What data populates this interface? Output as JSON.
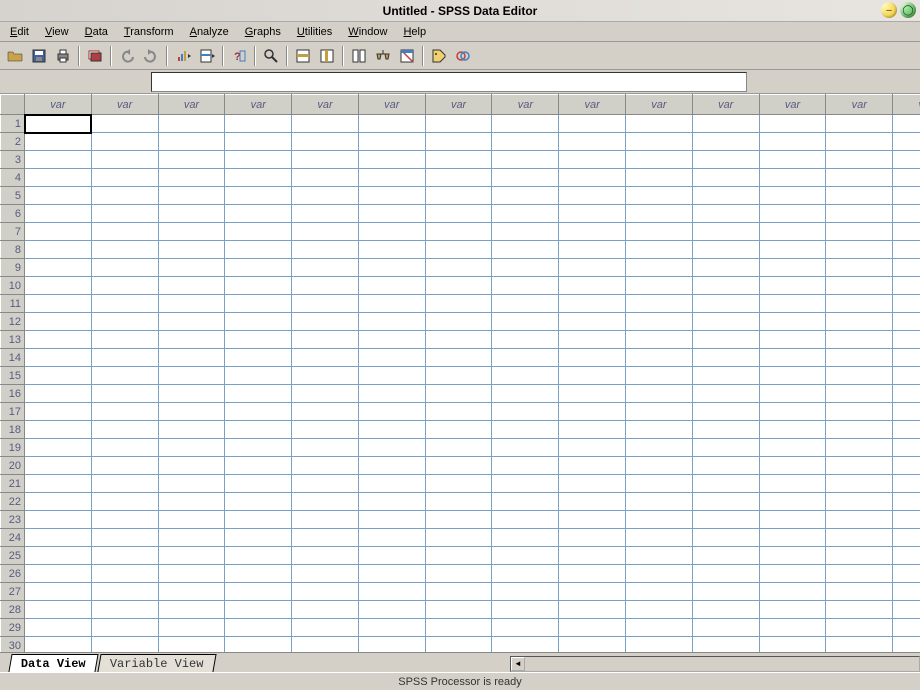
{
  "window": {
    "title": "Untitled - SPSS Data Editor"
  },
  "menus": {
    "edit": "Edit",
    "view": "View",
    "data": "Data",
    "transform": "Transform",
    "analyze": "Analyze",
    "graphs": "Graphs",
    "utilities": "Utilities",
    "window": "Window",
    "help": "Help"
  },
  "toolbar_icons": {
    "open": "open-icon",
    "save": "save-icon",
    "print": "print-icon",
    "dialog_recall": "dialog-recall-icon",
    "undo": "undo-icon",
    "redo": "redo-icon",
    "goto_chart": "goto-chart-icon",
    "goto_case": "goto-case-icon",
    "variables": "variables-icon",
    "find": "find-icon",
    "insert_case": "insert-case-icon",
    "insert_variable": "insert-variable-icon",
    "split_file": "split-file-icon",
    "weight_cases": "weight-cases-icon",
    "select_cases": "select-cases-icon",
    "value_labels": "value-labels-icon",
    "use_sets": "use-sets-icon"
  },
  "formula": {
    "cell_ref": "",
    "value": ""
  },
  "grid": {
    "column_label": "var",
    "num_columns": 14,
    "num_rows": 30,
    "active_row": 1,
    "active_col": 1
  },
  "tabs": {
    "data_view": "Data View",
    "variable_view": "Variable View"
  },
  "status": {
    "message": "SPSS Processor  is ready"
  }
}
